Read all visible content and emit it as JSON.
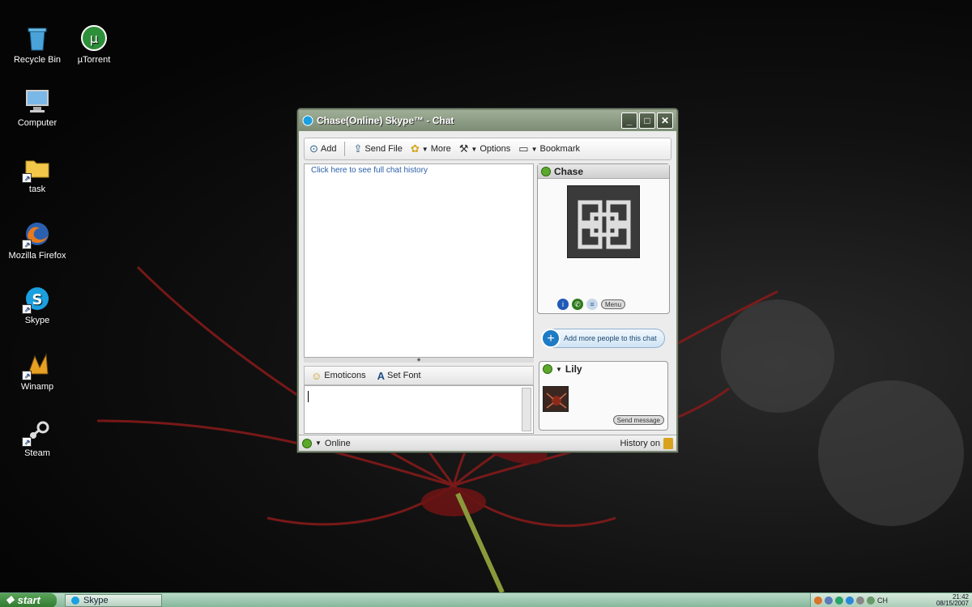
{
  "desktop": {
    "icons": [
      {
        "label": "Recycle Bin",
        "icon": "recycle-bin-icon"
      },
      {
        "label": "µTorrent",
        "icon": "utorrent-icon"
      },
      {
        "label": "Computer",
        "icon": "computer-icon"
      },
      {
        "label": "task",
        "icon": "folder-icon"
      },
      {
        "label": "Mozilla Firefox",
        "icon": "firefox-icon"
      },
      {
        "label": "Skype",
        "icon": "skype-icon"
      },
      {
        "label": "Winamp",
        "icon": "winamp-icon"
      },
      {
        "label": "Steam",
        "icon": "steam-icon"
      }
    ]
  },
  "window": {
    "title": "Chase(Online) Skype™ - Chat",
    "controls": {
      "minimize": "_",
      "maximize": "□",
      "close": "✕"
    }
  },
  "toolbar": {
    "add": "Add",
    "send_file": "Send File",
    "more": "More",
    "options": "Options",
    "bookmark": "Bookmark"
  },
  "chat": {
    "history_link": "Click here to see full chat history",
    "emoticons": "Emoticons",
    "set_font": "Set Font",
    "input_value": ""
  },
  "contact": {
    "name": "Chase",
    "status": "online",
    "menu_label": "Menu",
    "add_people": "Add more people to this chat"
  },
  "participant": {
    "name": "Lily",
    "send_label": "Send message"
  },
  "statusbar": {
    "status": "Online",
    "history": "History on"
  },
  "taskbar": {
    "start": "start",
    "task_item": "Skype",
    "lang": "CH",
    "time": "21:42",
    "date": "08/15/2007"
  },
  "colors": {
    "title_green": "#7d8c74",
    "link_blue": "#2a5fa8",
    "online_green": "#5ca82c",
    "taskbar_green": "#85b89b"
  }
}
